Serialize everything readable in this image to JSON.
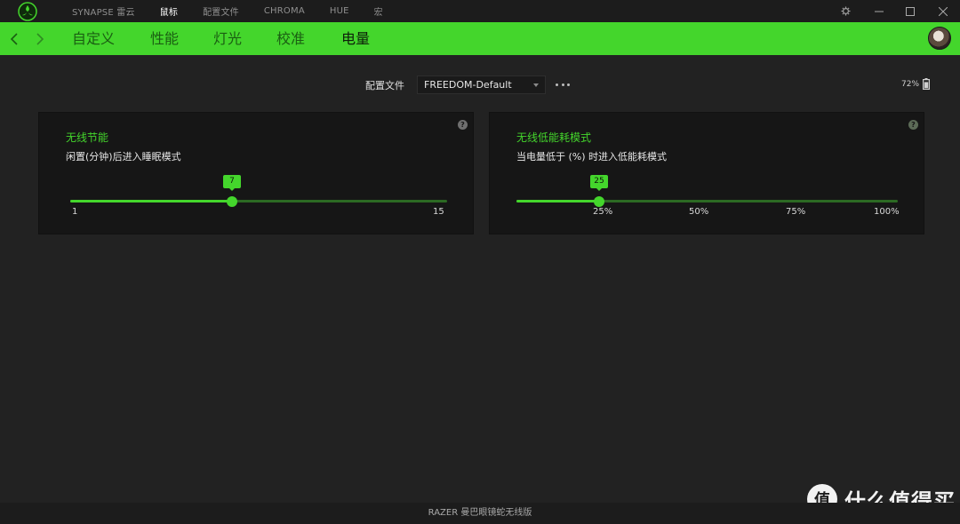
{
  "titlebar": {
    "nav": [
      {
        "label": "SYNAPSE 雷云",
        "active": false
      },
      {
        "label": "鼠标",
        "active": true
      },
      {
        "label": "配置文件",
        "active": false
      },
      {
        "label": "CHROMA",
        "active": false
      },
      {
        "label": "HUE",
        "active": false
      },
      {
        "label": "宏",
        "active": false
      }
    ],
    "icons": [
      "razer-logo",
      "gear-icon",
      "minimize-icon",
      "maximize-icon",
      "close-icon"
    ]
  },
  "subnav": {
    "tabs": [
      {
        "label": "自定义",
        "active": false
      },
      {
        "label": "性能",
        "active": false
      },
      {
        "label": "灯光",
        "active": false
      },
      {
        "label": "校准",
        "active": false
      },
      {
        "label": "电量",
        "active": true
      }
    ],
    "accent_color": "#44d62c"
  },
  "profile": {
    "label": "配置文件",
    "value": "FREEDOM-Default"
  },
  "battery": {
    "percent_text": "72%",
    "level": 0.72
  },
  "panels": {
    "sleep": {
      "title": "无线节能",
      "description": "闲置(分钟)后进入睡眠模式",
      "value_text": "7",
      "value": 7,
      "min": 1,
      "max": 15,
      "min_label": "1",
      "max_label": "15"
    },
    "low_power": {
      "title": "无线低能耗模式",
      "description": "当电量低于 (%) 时进入低能耗模式",
      "value_text": "25",
      "value": 25,
      "ticks": [
        "25%",
        "50%",
        "75%",
        "100%"
      ]
    }
  },
  "footer": {
    "device_name": "RAZER 曼巴眼镜蛇无线版"
  },
  "watermark": {
    "glyph": "值",
    "text": "什么值得买"
  }
}
